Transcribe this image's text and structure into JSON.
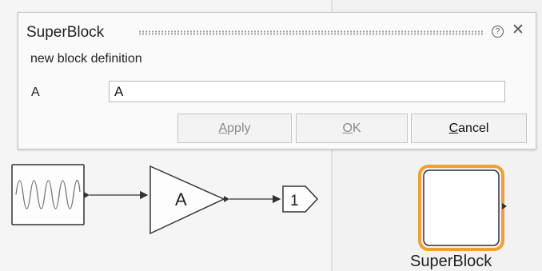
{
  "dialog": {
    "title": "SuperBlock",
    "description": "new block definition",
    "param_label": "A",
    "param_value": "A",
    "buttons": {
      "apply": {
        "mnemonic": "A",
        "rest": "pply"
      },
      "ok": {
        "mnemonic": "O",
        "rest": "K"
      },
      "cancel": {
        "mnemonic": "C",
        "rest": "ancel"
      }
    },
    "help_glyph": "?",
    "close_glyph": "✕",
    "help_icon": "help-circle-icon",
    "close_icon": "close-icon"
  },
  "diagram": {
    "gain_label": "A",
    "outport_label": "1",
    "superblock_label": "SuperBlock",
    "colors": {
      "superblock_highlight": "#f0a030",
      "block_stroke": "#333333",
      "signal": "#333333"
    }
  }
}
